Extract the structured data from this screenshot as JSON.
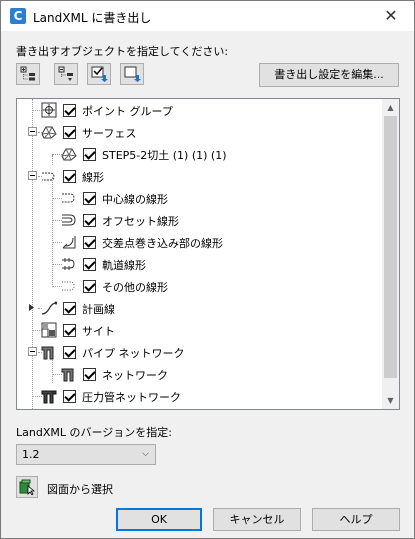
{
  "window": {
    "title": "LandXML に書き出し",
    "app_icon": "C"
  },
  "labels": {
    "objects_prompt": "書き出すオブジェクトを指定してください:",
    "version_prompt": "LandXML のバージョンを指定:",
    "pick_from_drawing": "図面から選択"
  },
  "buttons": {
    "edit_settings": "書き出し設定を編集...",
    "ok": "OK",
    "cancel": "キャンセル",
    "help": "ヘルプ"
  },
  "version": {
    "selected": "1.2"
  },
  "tree": {
    "items": [
      {
        "label": "ポイント グループ",
        "level": 1,
        "icon": "point-group-icon",
        "checked": true,
        "expander": false
      },
      {
        "label": "サーフェス",
        "level": 1,
        "icon": "surface-icon",
        "checked": true,
        "expander": true
      },
      {
        "label": "STEP5-2切土 (1) (1) (1)",
        "level": 2,
        "icon": "surface-icon",
        "checked": true,
        "expander": false
      },
      {
        "label": "線形",
        "level": 1,
        "icon": "alignment-icon",
        "checked": true,
        "expander": true
      },
      {
        "label": "中心線の線形",
        "level": 2,
        "icon": "centerline-alignment-icon",
        "checked": true,
        "expander": false
      },
      {
        "label": "オフセット線形",
        "level": 2,
        "icon": "offset-alignment-icon",
        "checked": true,
        "expander": false
      },
      {
        "label": "交差点巻き込み部の線形",
        "level": 2,
        "icon": "curb-return-alignment-icon",
        "checked": true,
        "expander": false
      },
      {
        "label": "軌道線形",
        "level": 2,
        "icon": "rail-alignment-icon",
        "checked": true,
        "expander": false
      },
      {
        "label": "その他の線形",
        "level": 2,
        "icon": "misc-alignment-icon",
        "checked": true,
        "expander": false
      },
      {
        "label": "計画線",
        "level": 1,
        "icon": "feature-line-icon",
        "checked": true,
        "expander": true
      },
      {
        "label": "サイト",
        "level": 1,
        "icon": "site-icon",
        "checked": true,
        "expander": false
      },
      {
        "label": "パイプ ネットワーク",
        "level": 1,
        "icon": "pipe-network-icon",
        "checked": true,
        "expander": true
      },
      {
        "label": "ネットワーク",
        "level": 2,
        "icon": "pipe-network-icon",
        "checked": true,
        "expander": false
      },
      {
        "label": "圧力管ネットワーク",
        "level": 1,
        "icon": "pressure-network-icon",
        "checked": true,
        "expander": false
      }
    ]
  },
  "colors": {
    "accent": "#0078d7",
    "brand": "#2b7fd1"
  }
}
